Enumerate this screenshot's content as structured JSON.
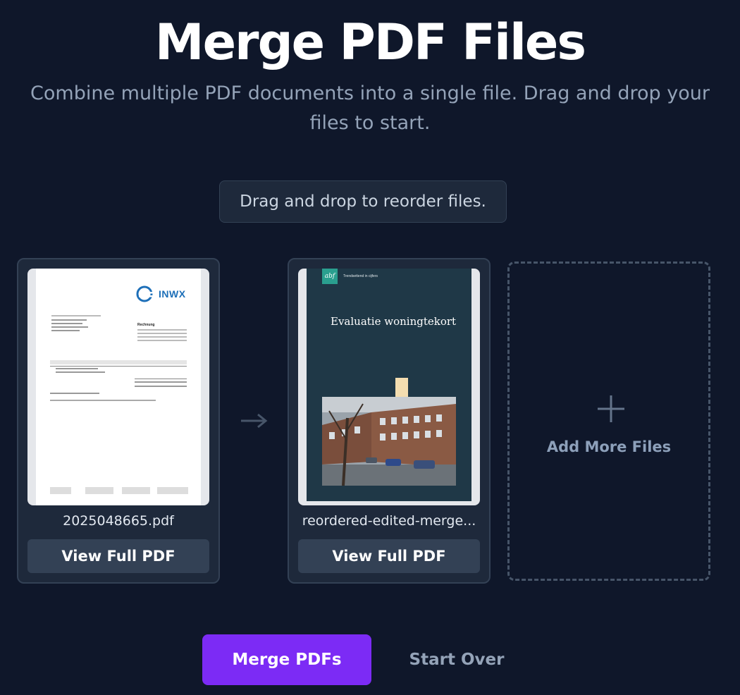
{
  "header": {
    "title": "Merge PDF Files",
    "subtitle": "Combine multiple PDF documents into a single file. Drag and drop your files to start."
  },
  "hint": "Drag and drop to reorder files.",
  "files": [
    {
      "filename": "2025048665.pdf",
      "view_label": "View Full PDF",
      "preview": {
        "logo_text": "INWX",
        "invoice_heading": "Rechnung",
        "line_item": "RBG .globegod.de"
      }
    },
    {
      "filename": "reordered-edited-merge...",
      "view_label": "View Full PDF",
      "preview": {
        "logo_text": "abf",
        "tagline": "Trendsettend in cijfers",
        "cover_title": "Evaluatie woningtekort"
      }
    }
  ],
  "add_more_label": "Add More Files",
  "actions": {
    "merge_label": "Merge PDFs",
    "start_over_label": "Start Over"
  },
  "colors": {
    "background": "#0f172a",
    "card": "#1e293b",
    "border": "#334155",
    "accent": "#7c2bf5",
    "muted_text": "#94a3b8"
  },
  "icons": [
    "arrow-right-icon",
    "plus-icon",
    "inwx-logo-icon",
    "abf-logo-icon"
  ]
}
